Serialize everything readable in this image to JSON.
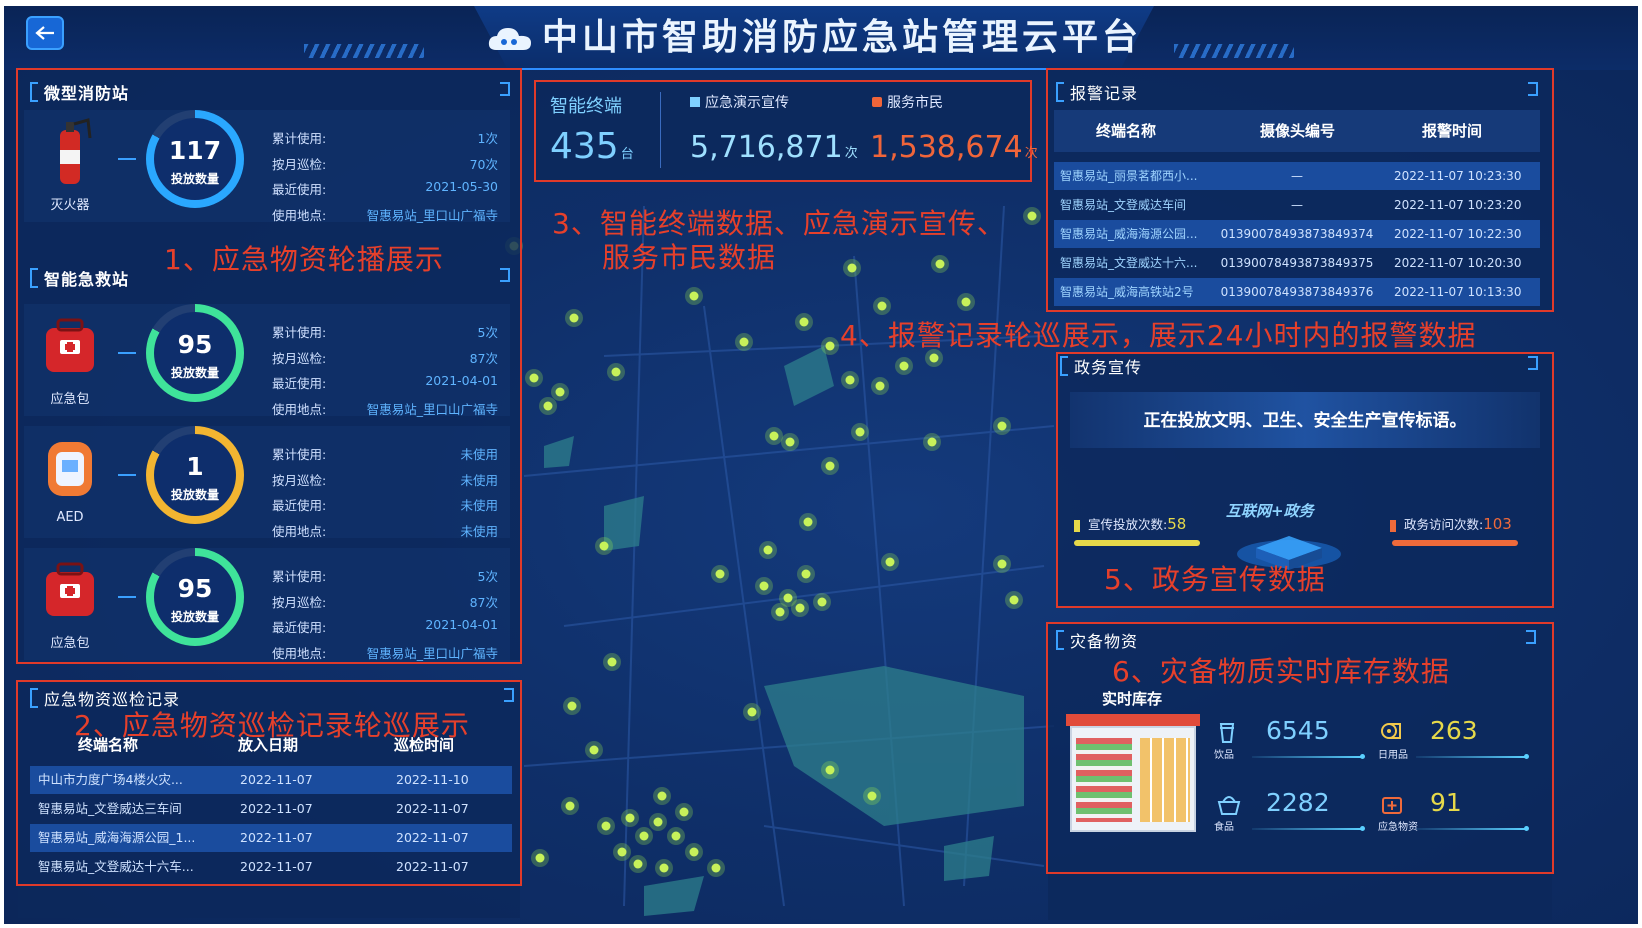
{
  "header": {
    "title": "中山市智助消防应急站管理云平台"
  },
  "annotations": {
    "a1": "1、应急物资轮播展示",
    "a2": "2、应急物资巡检记录轮巡展示",
    "a3_line1": "3、智能终端数据、应急演示宣传、",
    "a3_line2": "服务市民数据",
    "a4": "4、报警记录轮巡展示，展示24小时内的报警数据",
    "a5": "5、政务宣传数据",
    "a6": "6、灾备物质实时库存数据"
  },
  "micro_station": {
    "title": "微型消防站",
    "key_labels": [
      "累计使用:",
      "按月巡检:",
      "最近使用:",
      "使用地点:"
    ],
    "ring_caption": "投放数量",
    "items": [
      {
        "name": "灭火器",
        "count": "117",
        "values": [
          "1次",
          "70次",
          "2021-05-30",
          "智惠易站_里口山广福寺"
        ],
        "ring_color": "#2aa8ff"
      }
    ]
  },
  "smart_aid": {
    "title": "智能急救站",
    "items": [
      {
        "name": "应急包",
        "count": "95",
        "values": [
          "5次",
          "87次",
          "2021-04-01",
          "智惠易站_里口山广福寺"
        ],
        "ring_color": "#3fe39a"
      },
      {
        "name": "AED",
        "count": "1",
        "values": [
          "未使用",
          "未使用",
          "未使用",
          "未使用"
        ],
        "ring_color": "#f2b531"
      },
      {
        "name": "应急包",
        "count": "95",
        "values": [
          "5次",
          "87次",
          "2021-04-01",
          "智惠易站_里口山广福寺"
        ],
        "ring_color": "#3fe39a"
      }
    ]
  },
  "inspection": {
    "title": "应急物资巡检记录",
    "columns": [
      "终端名称",
      "放入日期",
      "巡检时间"
    ],
    "rows": [
      [
        "中山市力度广场4楼火灾...",
        "2022-11-07",
        "2022-11-10"
      ],
      [
        "智惠易站_文登威达三车间",
        "2022-11-07",
        "2022-11-07"
      ],
      [
        "智惠易站_威海海源公园_1...",
        "2022-11-07",
        "2022-11-07"
      ],
      [
        "智惠易站_文登威达十六车...",
        "2022-11-07",
        "2022-11-07"
      ]
    ]
  },
  "stats": {
    "terminal_label": "智能终端",
    "terminal_value": "435",
    "terminal_unit": "台",
    "demo_label": "应急演示宣传",
    "demo_value": "5,716,871",
    "demo_unit": "次",
    "service_label": "服务市民",
    "service_value": "1,538,674",
    "service_unit": "次"
  },
  "alarm": {
    "title": "报警记录",
    "columns": [
      "终端名称",
      "摄像头编号",
      "报警时间"
    ],
    "rows": [
      [
        "智惠易站_丽景茗都西小...",
        "—",
        "2022-11-07 10:23:30"
      ],
      [
        "智惠易站_文登威达车间",
        "—",
        "2022-11-07 10:23:20"
      ],
      [
        "智惠易站_威海海源公园...",
        "013900784938738493​74",
        "2022-11-07 10:22:30"
      ],
      [
        "智惠易站_文登威达十六...",
        "01390078493873849375",
        "2022-11-07 10:20:30"
      ],
      [
        "智惠易站_威海高铁站2号",
        "01390078493873849376",
        "2022-11-07 10:13:30"
      ]
    ]
  },
  "gov": {
    "title": "政务宣传",
    "banner": "正在投放文明、卫生、安全生产宣传标语。",
    "left_label": "宣传投放次数:",
    "left_value": "58",
    "right_label": "政务访问次数:",
    "right_value": "103",
    "logo_text": "互联网+政务"
  },
  "supplies": {
    "title": "灾备物资",
    "subtitle": "实时库存",
    "items": [
      {
        "name": "饮品",
        "value": "6545"
      },
      {
        "name": "日用品",
        "value": "263"
      },
      {
        "name": "食品",
        "value": "2282"
      },
      {
        "name": "应急物资",
        "value": "91"
      }
    ]
  }
}
